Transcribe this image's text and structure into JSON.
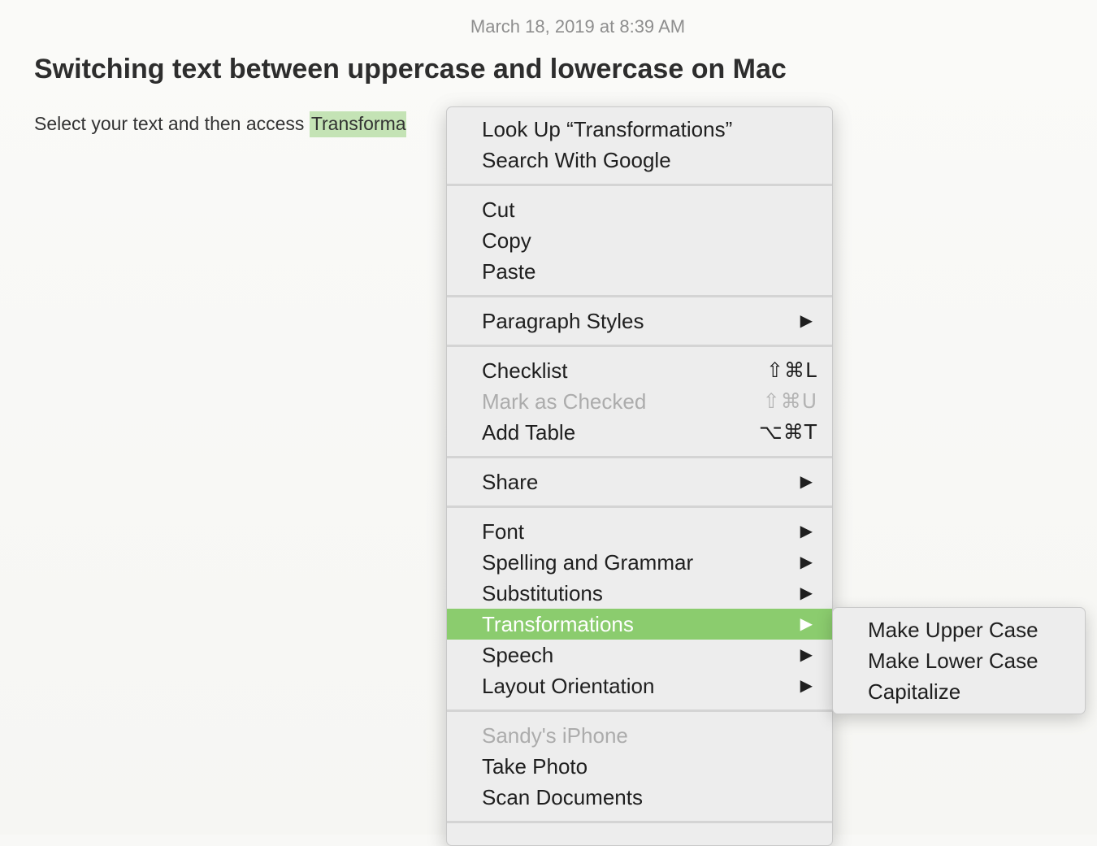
{
  "note": {
    "date": "March 18, 2019 at 8:39 AM",
    "title": "Switching text between uppercase and lowercase on Mac",
    "body_prefix": "Select your text and then access ",
    "body_selected": "Transforma"
  },
  "context_menu": {
    "group1": {
      "look_up": "Look Up “Transformations”",
      "search_google": "Search With Google"
    },
    "group2": {
      "cut": "Cut",
      "copy": "Copy",
      "paste": "Paste"
    },
    "group3": {
      "paragraph_styles": "Paragraph Styles"
    },
    "group4": {
      "checklist": "Checklist",
      "checklist_shortcut": "⇧⌘L",
      "mark_checked": "Mark as Checked",
      "mark_checked_shortcut": "⇧⌘U",
      "add_table": "Add Table",
      "add_table_shortcut": "⌥⌘T"
    },
    "group5": {
      "share": "Share"
    },
    "group6": {
      "font": "Font",
      "spelling": "Spelling and Grammar",
      "substitutions": "Substitutions",
      "transformations": "Transformations",
      "speech": "Speech",
      "layout_orientation": "Layout Orientation"
    },
    "group7": {
      "device": "Sandy's iPhone",
      "take_photo": "Take Photo",
      "scan_documents": "Scan Documents"
    },
    "submenu_arrow": "▶"
  },
  "transformations_submenu": {
    "upper": "Make Upper Case",
    "lower": "Make Lower Case",
    "capitalize": "Capitalize"
  },
  "colors": {
    "highlight": "#8bcc6e",
    "selection": "#c4e3b5"
  }
}
